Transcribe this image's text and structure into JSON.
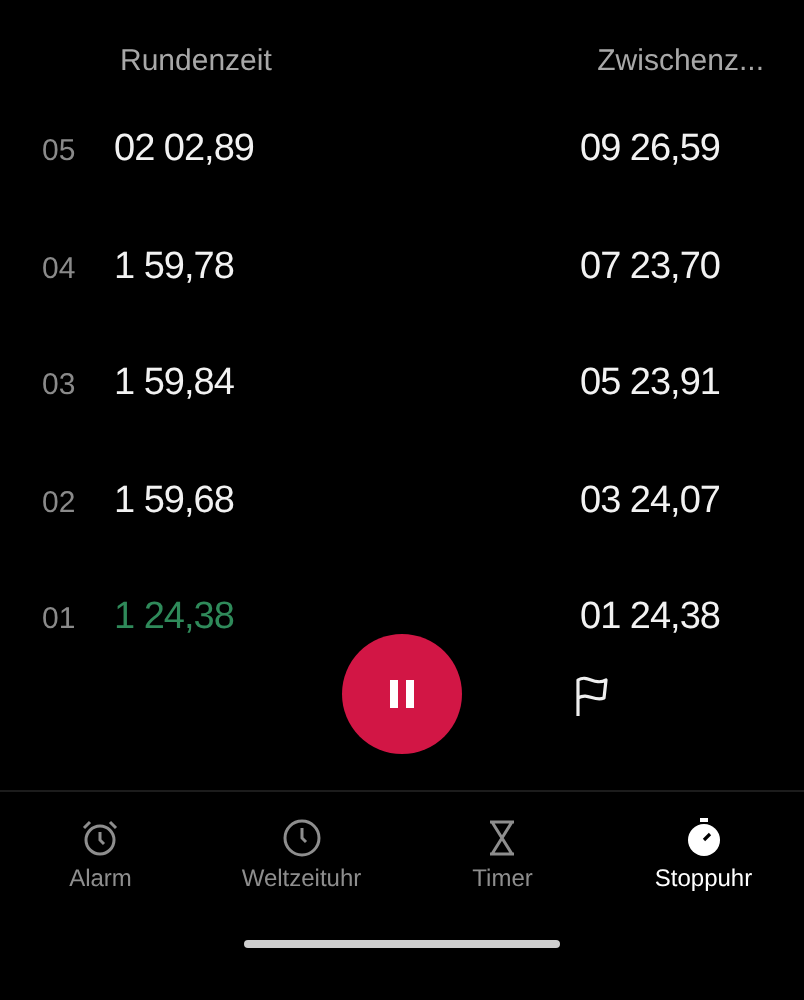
{
  "columns": {
    "lap_time": "Rundenzeit",
    "total": "Zwischenz..."
  },
  "laps": [
    {
      "number": "05",
      "time": "02 02,89",
      "total": "09 26,59",
      "fastest": false
    },
    {
      "number": "04",
      "time": "1 59,78",
      "total": "07 23,70",
      "fastest": false
    },
    {
      "number": "03",
      "time": "1 59,84",
      "total": "05 23,91",
      "fastest": false
    },
    {
      "number": "02",
      "time": "1 59,68",
      "total": "03 24,07",
      "fastest": false
    },
    {
      "number": "01",
      "time": "1 24,38",
      "total": "01 24,38",
      "fastest": true
    }
  ],
  "tabs": [
    {
      "label": "Alarm",
      "selected": false
    },
    {
      "label": "Weltzeituhr",
      "selected": false
    },
    {
      "label": "Timer",
      "selected": false
    },
    {
      "label": "Stoppuhr",
      "selected": true
    }
  ]
}
